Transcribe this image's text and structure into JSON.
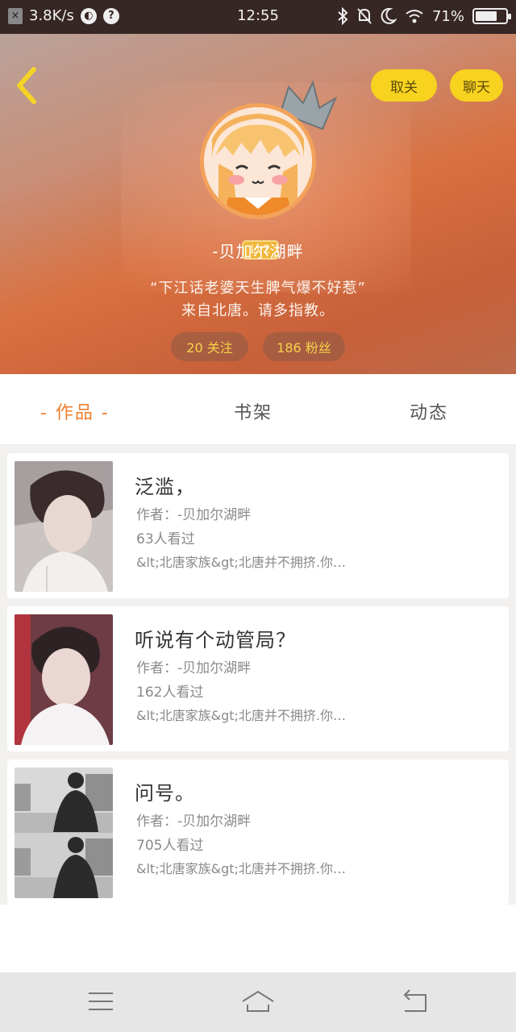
{
  "status_bar": {
    "speed": "3.8K/s",
    "time": "12:55",
    "battery": "71%",
    "battery_level": 0.71
  },
  "header": {
    "unfollow_label": "取关",
    "chat_label": "聊天",
    "level": "Lv2",
    "username": "-贝加尔湖畔",
    "bio_line1": "“下江话老婆天生脾气爆不好惹”",
    "bio_line2": "来自北唐。请多指教。",
    "following": "20 关注",
    "fans": "186 粉丝",
    "accent": "#f7d21f"
  },
  "tabs": [
    {
      "label": "- 作品 -",
      "active": true
    },
    {
      "label": "书架",
      "active": false
    },
    {
      "label": "动态",
      "active": false
    }
  ],
  "works": [
    {
      "title": "泛滥，",
      "author": "作者：-贝加尔湖畔",
      "views": "63人看过",
      "desc": "&lt;北唐家族&gt;北唐并不拥挤.你…"
    },
    {
      "title": "听说有个动管局？",
      "author": "作者：-贝加尔湖畔",
      "views": "162人看过",
      "desc": "&lt;北唐家族&gt;北唐并不拥挤.你…"
    },
    {
      "title": "问号。",
      "author": "作者：-贝加尔湖畔",
      "views": "705人看过",
      "desc": "&lt;北唐家族&gt;北唐并不拥挤.你…"
    }
  ],
  "icons": [
    "back-arrow-icon",
    "menu-icon",
    "home-icon",
    "return-icon",
    "bluetooth-icon",
    "mute-icon",
    "moon-icon",
    "wifi-icon",
    "battery-icon"
  ]
}
